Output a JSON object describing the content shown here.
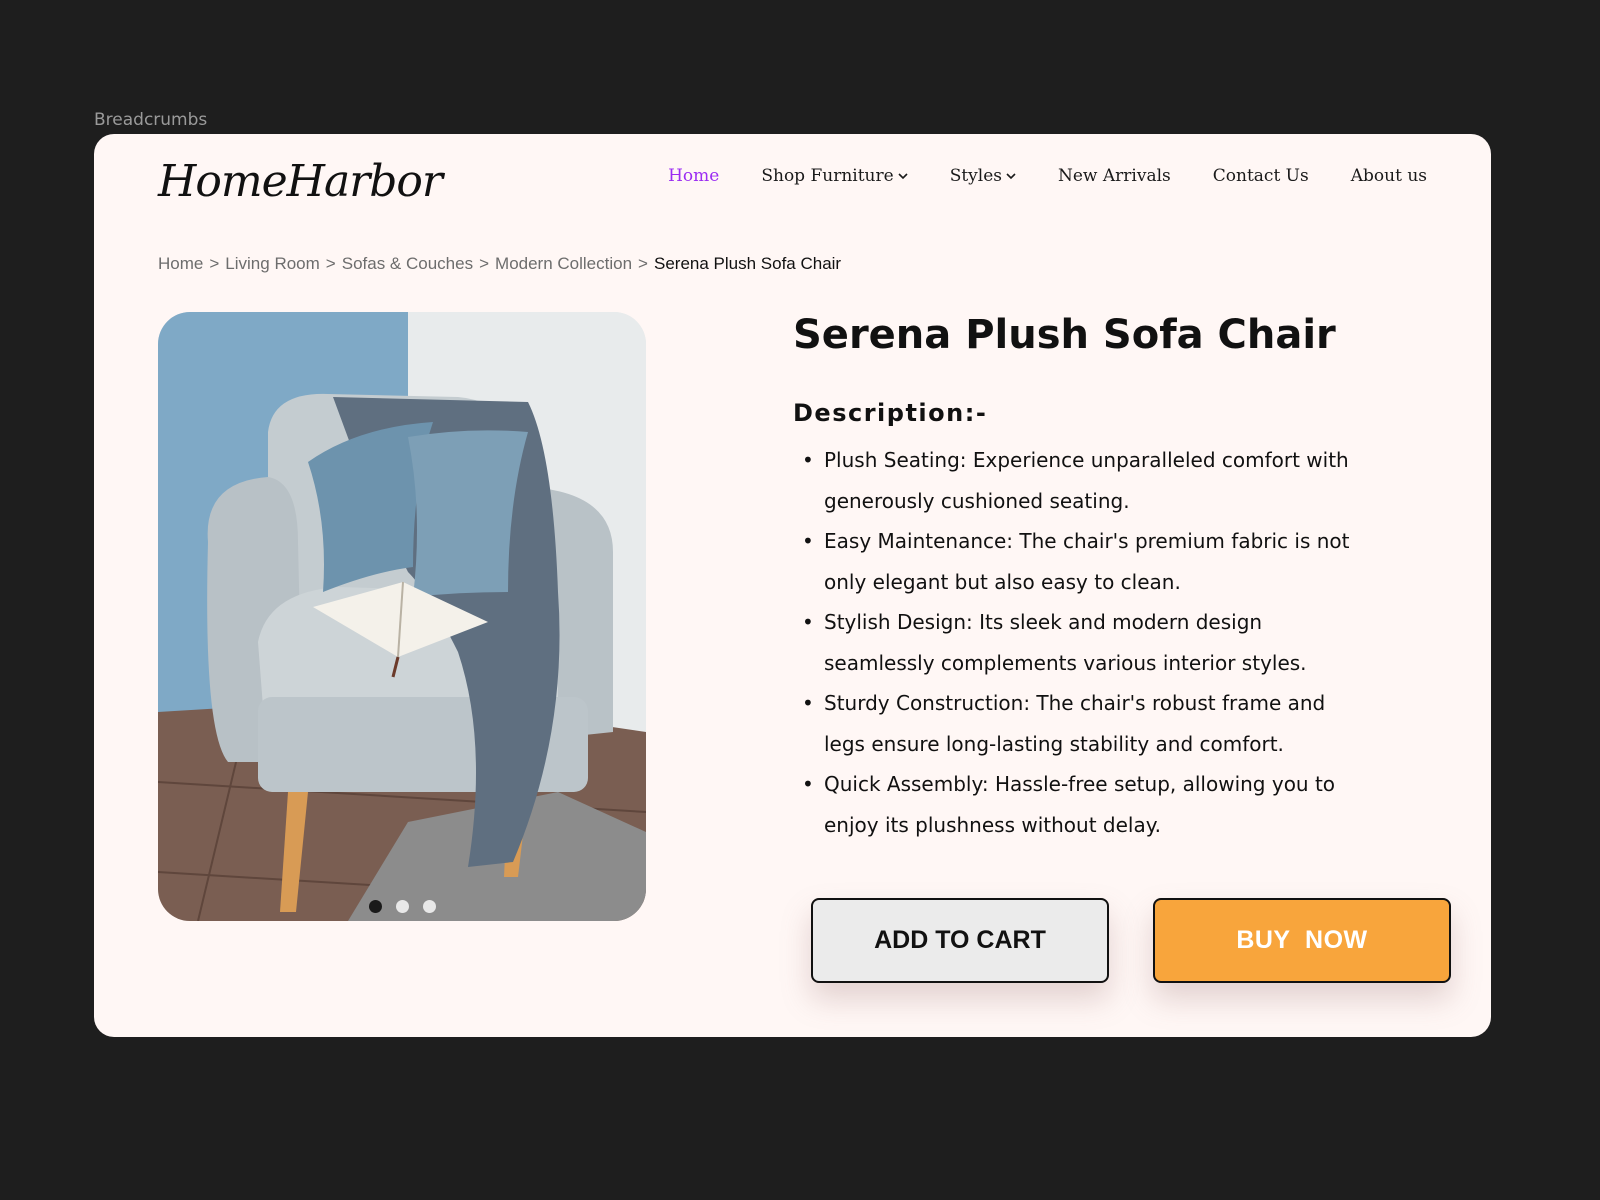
{
  "frame_label": "Breadcrumbs",
  "header": {
    "logo": "HomeHarbor",
    "nav": [
      {
        "label": "Home",
        "active": true,
        "dropdown": false
      },
      {
        "label": "Shop Furniture",
        "active": false,
        "dropdown": true
      },
      {
        "label": "Styles",
        "active": false,
        "dropdown": true
      },
      {
        "label": "New Arrivals",
        "active": false,
        "dropdown": false
      },
      {
        "label": "Contact Us",
        "active": false,
        "dropdown": false
      },
      {
        "label": "About us",
        "active": false,
        "dropdown": false
      }
    ]
  },
  "breadcrumb": {
    "separator": ">",
    "items": [
      "Home",
      "Living Room",
      "Sofas & Couches",
      "Modern Collection",
      "Serena Plush Sofa Chair"
    ]
  },
  "product": {
    "title": "Serena Plush Sofa Chair",
    "description_heading": "Description:-",
    "description": [
      "Plush Seating: Experience unparalleled comfort with generously cushioned seating.",
      "Easy Maintenance: The chair's premium fabric is not only elegant but also easy to clean.",
      "Stylish Design: Its sleek and modern design seamlessly complements various interior styles.",
      "Sturdy Construction: The chair's robust frame and legs ensure long-lasting stability and comfort.",
      "Quick Assembly: Hassle-free setup, allowing you to enjoy its plushness without delay."
    ],
    "carousel": {
      "count": 3,
      "active_index": 0
    }
  },
  "actions": {
    "add_to_cart": "ADD TO CART",
    "buy_now": "BUY  NOW"
  },
  "colors": {
    "page_bg": "#1e1e1e",
    "card_bg": "#fff7f5",
    "nav_active": "#9b2cf2",
    "buy_button": "#f8a53c",
    "cart_button": "#ebebeb"
  }
}
